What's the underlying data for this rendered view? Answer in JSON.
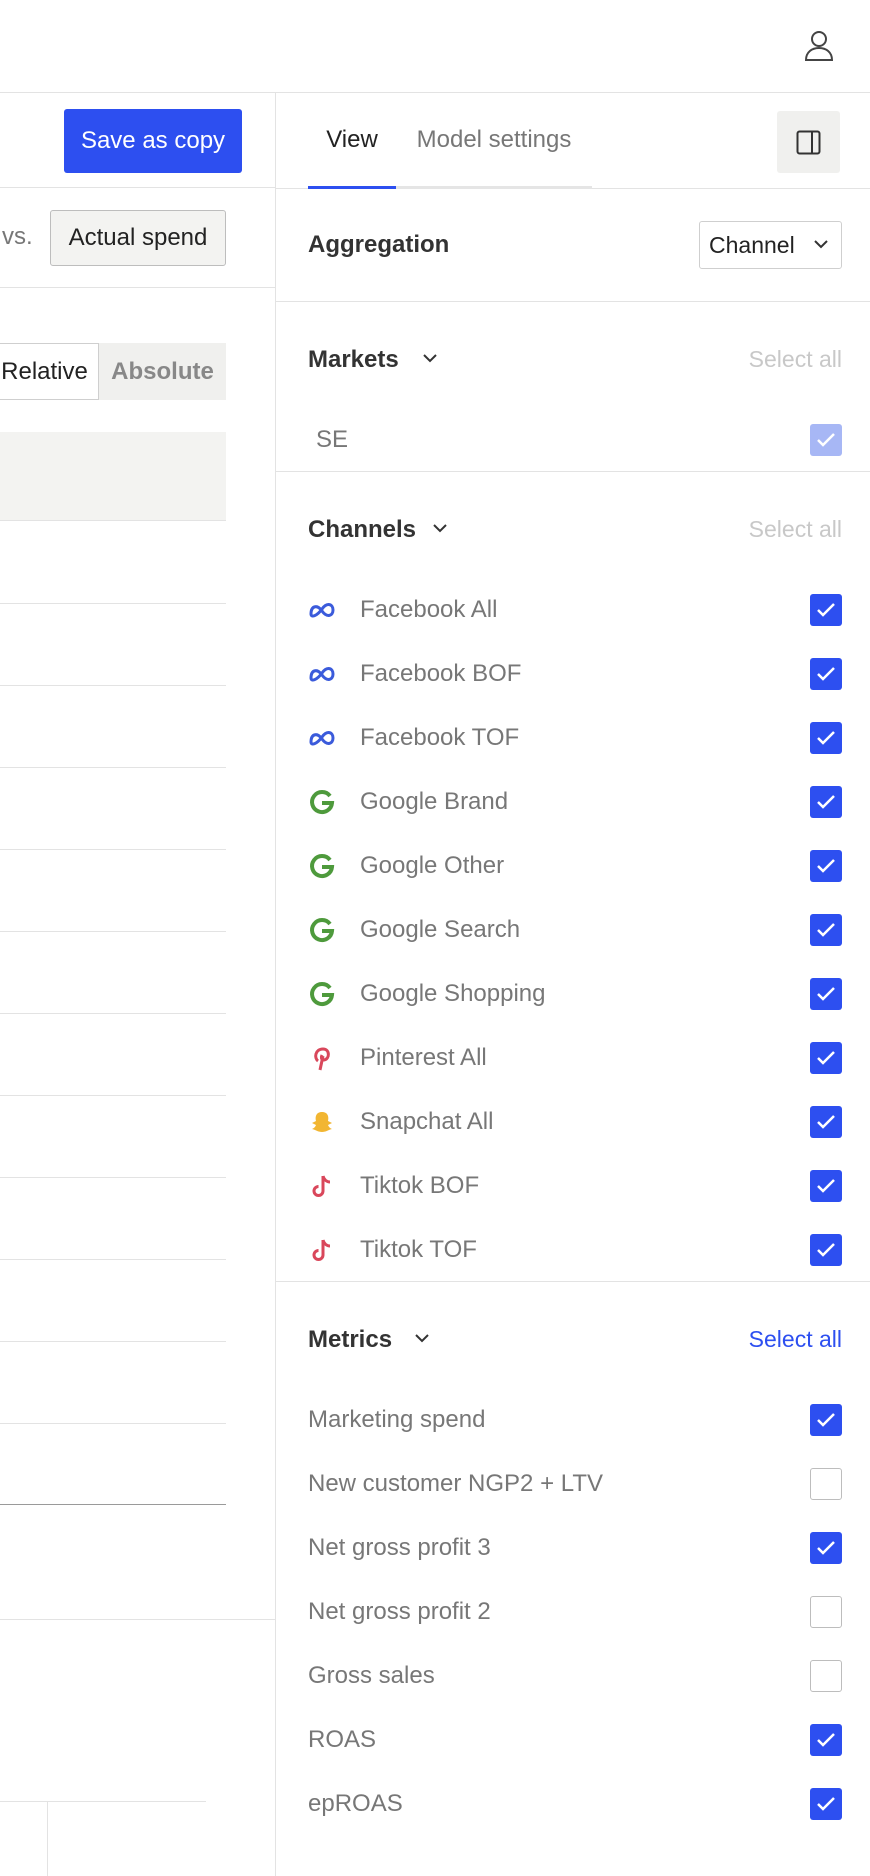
{
  "header": {
    "user_icon": "user-icon"
  },
  "left": {
    "save_copy_label": "Save as copy",
    "vs_label": "vs.",
    "actual_spend_label": "Actual spend",
    "toggle": {
      "relative": "Relative",
      "absolute": "Absolute"
    }
  },
  "tabs": {
    "view": "View",
    "model_settings": "Model settings"
  },
  "aggregation": {
    "label": "Aggregation",
    "value": "Channel"
  },
  "markets": {
    "title": "Markets",
    "select_all": "Select all",
    "items": [
      {
        "label": "SE",
        "checked": true
      }
    ]
  },
  "channels": {
    "title": "Channels",
    "select_all": "Select all",
    "items": [
      {
        "label": "Facebook All",
        "icon": "meta-icon",
        "checked": true
      },
      {
        "label": "Facebook BOF",
        "icon": "meta-icon",
        "checked": true
      },
      {
        "label": "Facebook TOF",
        "icon": "meta-icon",
        "checked": true
      },
      {
        "label": "Google Brand",
        "icon": "google-icon",
        "checked": true
      },
      {
        "label": "Google Other",
        "icon": "google-icon",
        "checked": true
      },
      {
        "label": "Google Search",
        "icon": "google-icon",
        "checked": true
      },
      {
        "label": "Google Shopping",
        "icon": "google-icon",
        "checked": true
      },
      {
        "label": "Pinterest All",
        "icon": "pinterest-icon",
        "checked": true
      },
      {
        "label": "Snapchat All",
        "icon": "snapchat-icon",
        "checked": true
      },
      {
        "label": "Tiktok BOF",
        "icon": "tiktok-icon",
        "checked": true
      },
      {
        "label": "Tiktok TOF",
        "icon": "tiktok-icon",
        "checked": true
      }
    ]
  },
  "metrics": {
    "title": "Metrics",
    "select_all": "Select all",
    "items": [
      {
        "label": "Marketing spend",
        "checked": true
      },
      {
        "label": "New customer NGP2 + LTV",
        "checked": false
      },
      {
        "label": "Net gross profit 3",
        "checked": true
      },
      {
        "label": "Net gross profit 2",
        "checked": false
      },
      {
        "label": "Gross sales",
        "checked": false
      },
      {
        "label": "ROAS",
        "checked": true
      },
      {
        "label": "epROAS",
        "checked": true
      }
    ]
  },
  "colors": {
    "accent": "#2d4ff0",
    "meta": "#3b5bdb",
    "google": "#4e9a3c",
    "pinterest": "#d9475b",
    "snapchat": "#f2b632",
    "tiktok": "#d9475b"
  }
}
